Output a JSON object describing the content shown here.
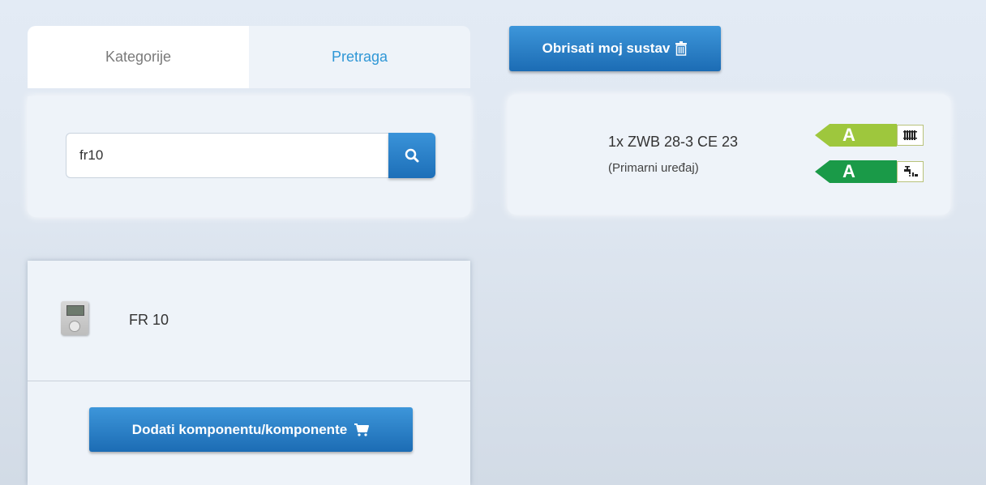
{
  "tabs": {
    "categories_label": "Kategorije",
    "search_label": "Pretraga"
  },
  "search": {
    "value": "fr10",
    "icon": "search-icon"
  },
  "results": {
    "items": [
      {
        "name": "FR 10",
        "icon": "thermostat-thumbnail"
      }
    ],
    "add_button_label": "Dodati komponentu/komponente",
    "add_button_icon": "cart-icon"
  },
  "system": {
    "clear_button_label": "Obrisati moj sustav",
    "clear_button_icon": "trash-icon",
    "device": {
      "line1": "1x ZWB 28-3 CE 23",
      "line2": "(Primarni uređaj)"
    },
    "energy_labels": [
      {
        "class": "A",
        "color": "#9ec73d",
        "icon": "radiator-icon"
      },
      {
        "class": "A",
        "color": "#1a9a48",
        "icon": "tap-icon"
      }
    ]
  },
  "colors": {
    "accent": "#2f97d6",
    "button": "#1d6fb8"
  }
}
